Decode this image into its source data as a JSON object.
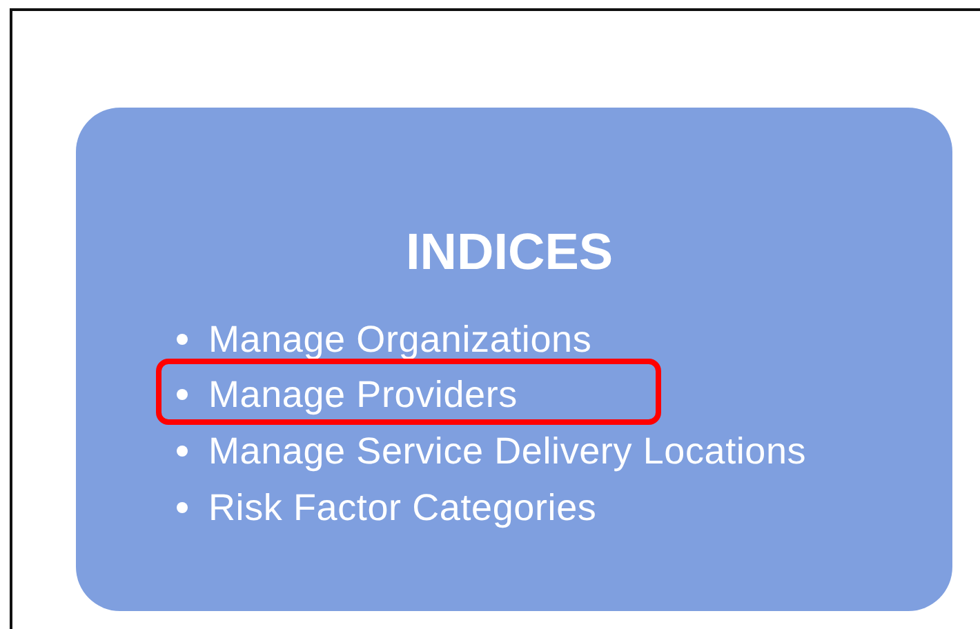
{
  "card": {
    "title": "INDICES",
    "items": [
      {
        "label": "Manage Organizations",
        "highlighted": false
      },
      {
        "label": "Manage Providers",
        "highlighted": true
      },
      {
        "label": "Manage Service Delivery Locations",
        "highlighted": false
      },
      {
        "label": "Risk Factor Categories",
        "highlighted": false
      }
    ]
  }
}
